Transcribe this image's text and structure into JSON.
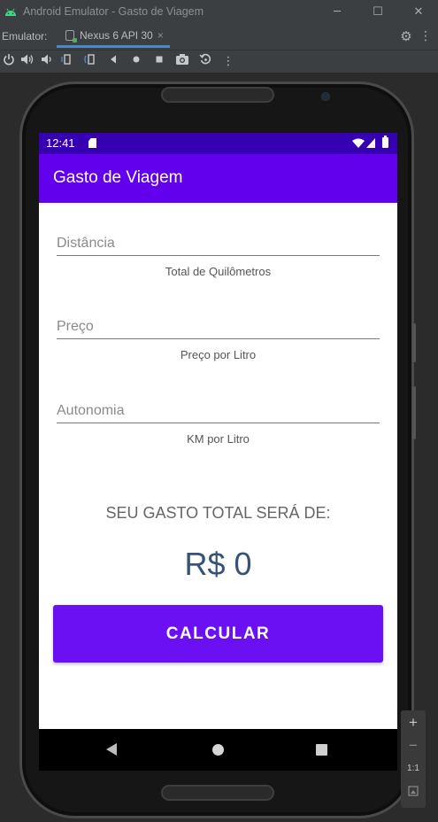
{
  "window": {
    "title": "Android Emulator - Gasto de Viagem",
    "minimize_glyph": "─",
    "maximize_glyph": "☐",
    "close_glyph": "✕"
  },
  "emulator_bar": {
    "label": "Emulator:",
    "tab_label": "Nexus 6 API 30",
    "tab_close": "×"
  },
  "toolbar_icons": [
    "power-icon",
    "volume-up-icon",
    "volume-down-icon",
    "rotate-left-icon",
    "rotate-right-icon",
    "back-icon",
    "home-icon",
    "overview-icon",
    "screenshot-icon",
    "snapshot-icon",
    "more-icon"
  ],
  "status_bar": {
    "time": "12:41"
  },
  "app": {
    "title": "Gasto de Viagem",
    "fields": [
      {
        "hint": "Distância",
        "caption": "Total de Quilômetros"
      },
      {
        "hint": "Preço",
        "caption": "Preço por Litro"
      },
      {
        "hint": "Autonomia",
        "caption": "KM por Litro"
      }
    ],
    "total_label": "SEU GASTO TOTAL SERÁ DE:",
    "total_value": "R$ 0",
    "button_label": "CALCULAR"
  },
  "zoom_panel": {
    "zoom_in": "+",
    "zoom_out": "−",
    "one_to_one": "1:1"
  },
  "colors": {
    "status_bar": "#3700b3",
    "app_bar": "#6200ee",
    "button": "#6a10f2",
    "total_value": "#355377"
  }
}
